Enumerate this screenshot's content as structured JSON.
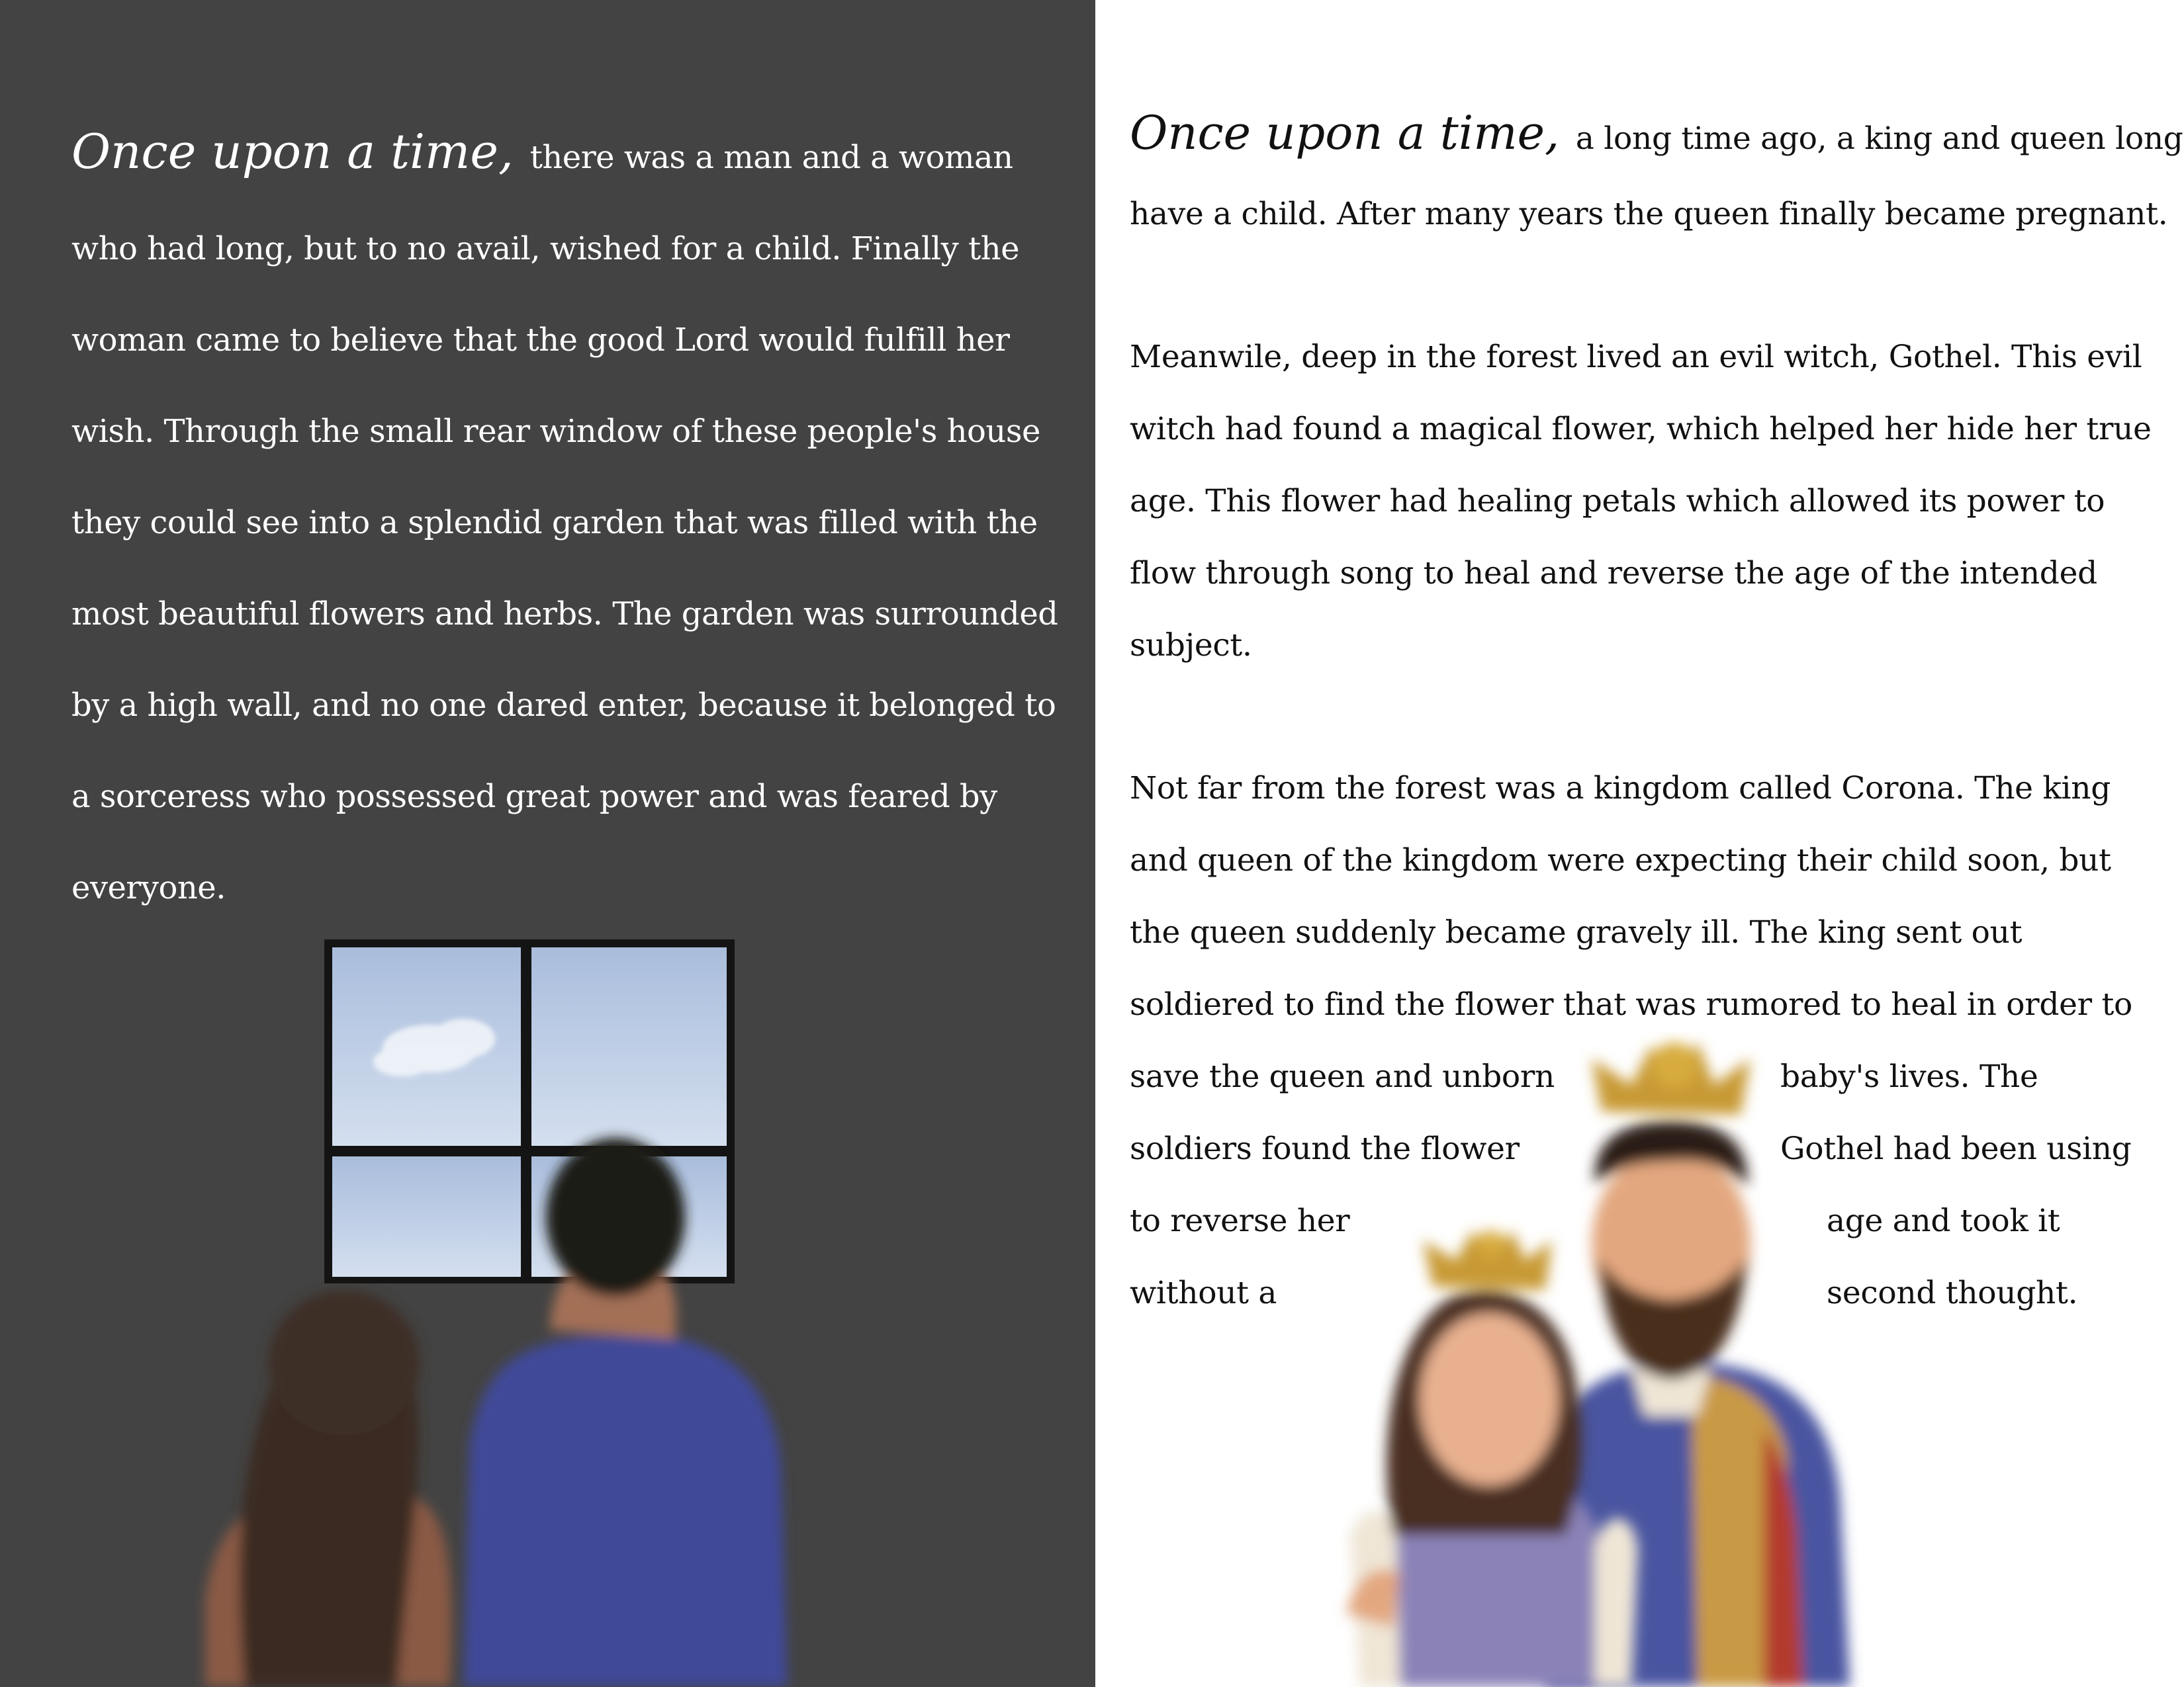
{
  "left_page": {
    "opening": "Once upon a time,",
    "text": "there was a man and a woman who had long, but to no avail, wished for a child. Finally the woman came to believe that the good Lord would fulfill her wish. Through the small rear window of these people's house they could see into a splendid garden that was filled with the most beautiful flowers and herbs. The garden was surrounded by a high wall, and no one dared enter, because it belonged to a sorceress who possessed great power and was feared by everyone."
  },
  "right_page": {
    "opening": "Once upon a time,",
    "p1_l1": "a long time ago, a king and queen longed to",
    "p1_l2": "have a child. After many years the queen finally became pregnant.",
    "p2_l1": "Meanwile, deep in the forest lived an evil witch, Gothel. This evil",
    "p2_l2": "witch had found a magical flower, which helped her hide her true",
    "p2_l3": "age. This flower had healing petals which allowed its power to",
    "p2_l4": "flow through song to heal and reverse the age of the intended",
    "p2_l5": "subject.",
    "p3_l1": "Not far from the forest was a kingdom called Corona. The king",
    "p3_l2": "and queen of the kingdom were expecting their child soon, but",
    "p3_l3": "the queen suddenly became gravely ill. The king sent out",
    "p3_l4": "soldiered to find the flower that was rumored to heal in order to",
    "p3_l5a": "save the queen and unborn",
    "p3_l5b": "baby's lives. The",
    "p3_l6a": "soldiers found the flower",
    "p3_l6b": "Gothel had been using",
    "p3_l7a": "to reverse her",
    "p3_l7b": "age and took it",
    "p3_l8a": "without a",
    "p3_l8b": "second thought."
  },
  "colors": {
    "left_background": "#434343",
    "right_background": "#ffffff",
    "left_text": "#ffffff",
    "right_text": "#111111",
    "tunic_blue": "#3f4a98",
    "crown_gold": "#c89a34"
  }
}
